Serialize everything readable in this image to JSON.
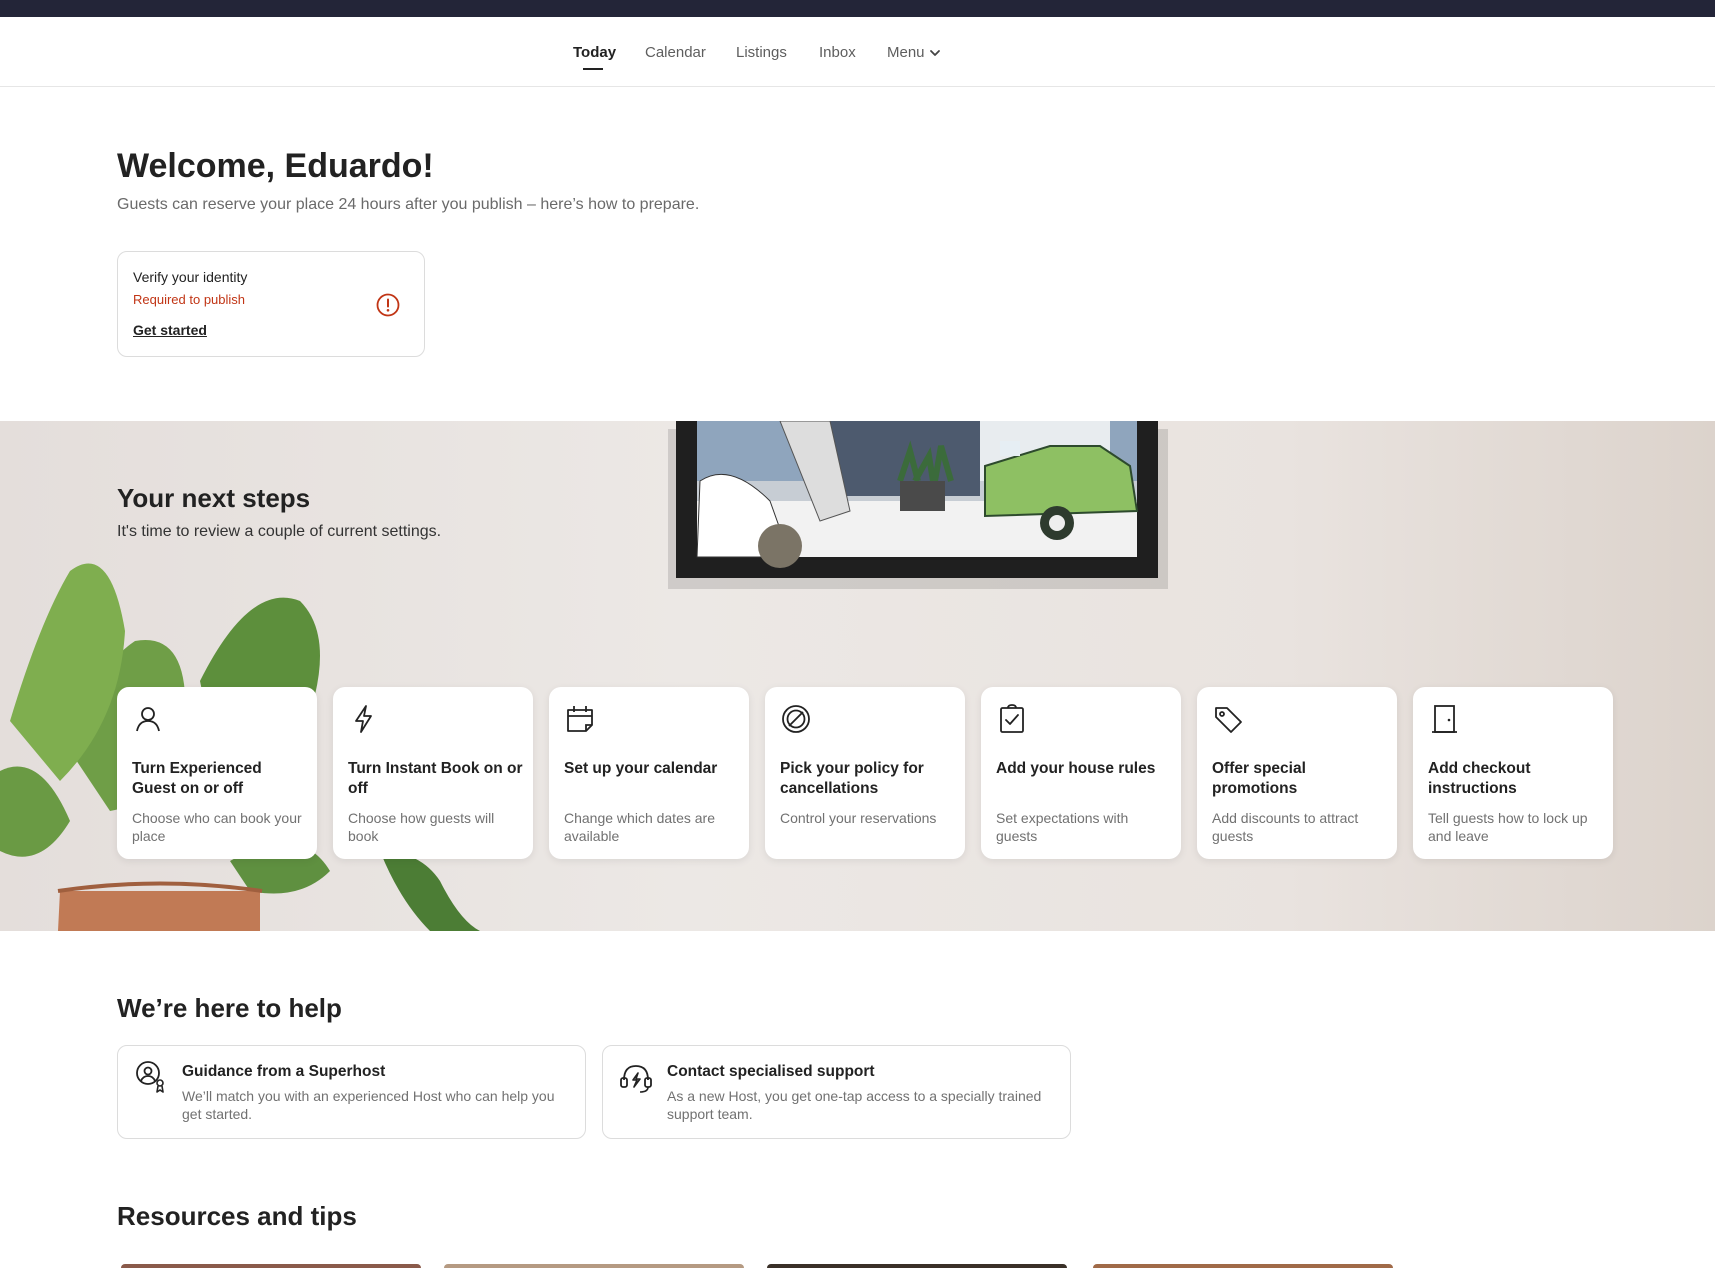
{
  "nav": {
    "items": [
      {
        "label": "Today",
        "active": true
      },
      {
        "label": "Calendar",
        "active": false
      },
      {
        "label": "Listings",
        "active": false
      },
      {
        "label": "Inbox",
        "active": false
      },
      {
        "label": "Menu",
        "active": false
      }
    ]
  },
  "welcome": {
    "title": "Welcome, Eduardo!",
    "subtitle": "Guests can reserve your place 24 hours after you publish – here’s how to prepare."
  },
  "verify": {
    "title": "Verify your identity",
    "status": "Required to publish",
    "link": "Get started",
    "icon": "alert-circle-icon",
    "status_color": "#c13515"
  },
  "next_steps": {
    "title": "Your next steps",
    "subtitle": "It's time to review a couple of current settings.",
    "cards": [
      {
        "icon": "person-icon",
        "title": "Turn Experienced Guest on or off",
        "desc": "Choose who can book your place"
      },
      {
        "icon": "lightning-icon",
        "title": "Turn Instant Book on or off",
        "desc": "Choose how guests will book"
      },
      {
        "icon": "calendar-icon",
        "title": "Set up your calendar",
        "desc": "Change which dates are available"
      },
      {
        "icon": "no-symbol-icon",
        "title": "Pick your policy for cancellations",
        "desc": "Control your reservations"
      },
      {
        "icon": "clipboard-check-icon",
        "title": "Add your house rules",
        "desc": "Set expectations with guests"
      },
      {
        "icon": "tag-icon",
        "title": "Offer special promotions",
        "desc": "Add discounts to attract guests"
      },
      {
        "icon": "door-icon",
        "title": "Add checkout instructions",
        "desc": "Tell guests how to lock up and leave"
      }
    ]
  },
  "help": {
    "title": "We’re here to help",
    "cards": [
      {
        "icon": "superhost-guidance-icon",
        "title": "Guidance from a Superhost",
        "desc": "We’ll match you with an experienced Host who can help you get started."
      },
      {
        "icon": "support-headset-icon",
        "title": "Contact specialised support",
        "desc": "As a new Host, you get one-tap access to a specially trained support team."
      }
    ]
  },
  "resources": {
    "title": "Resources and tips"
  }
}
